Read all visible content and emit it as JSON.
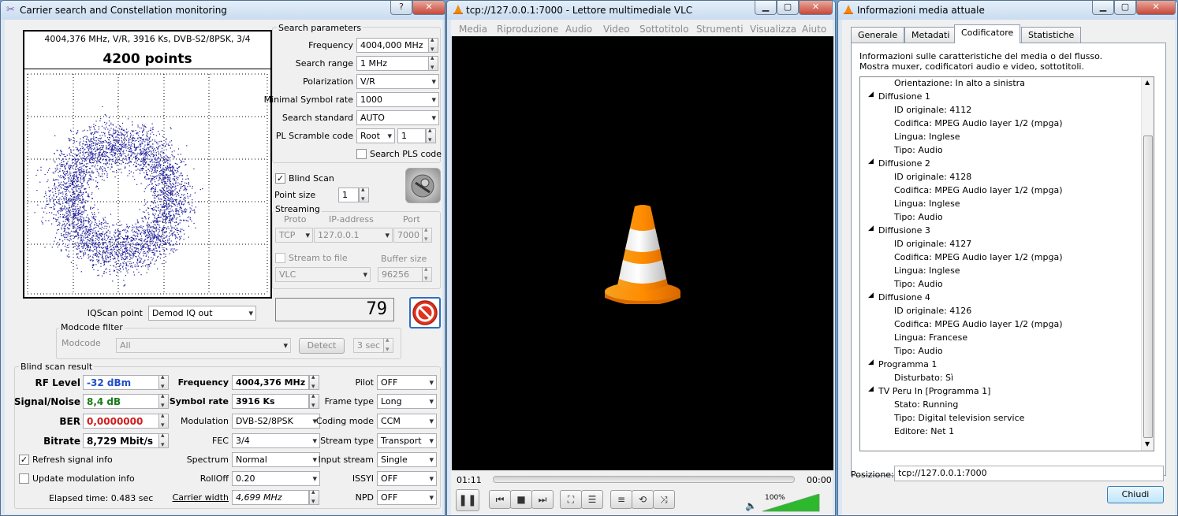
{
  "carrier": {
    "title": "Carrier search and Constellation monitoring",
    "help_btn": "?",
    "close_btn": "✕",
    "plot_header": "4004,376 MHz, V/R, 3916 Ks, DVB-S2/8PSK, 3/4",
    "plot_points": "4200 points",
    "search_params_title": "Search parameters",
    "frequency_label": "Frequency",
    "frequency_value": "4004,000 MHz",
    "range_label": "Search range",
    "range_value": "1 MHz",
    "polarization_label": "Polarization",
    "polarization_value": "V/R",
    "min_sr_label": "Minimal Symbol rate",
    "min_sr_value": "1000",
    "standard_label": "Search standard",
    "standard_value": "AUTO",
    "pl_label": "PL Scramble code",
    "pl_mode": "Root",
    "pl_value": "1",
    "pls_label": "Search PLS code",
    "blind_scan_label": "Blind Scan",
    "point_size_label": "Point size",
    "point_size_value": "1",
    "streaming_title": "Streaming",
    "proto_label": "Proto",
    "ip_label": "IP-address",
    "port_label": "Port",
    "proto_value": "TCP",
    "ip_value": "127.0.0.1",
    "port_value": "7000",
    "stream_file_label": "Stream to file",
    "buffer_label": "Buffer size",
    "player_value": "VLC",
    "buffer_value": "96256",
    "counter_value": "79",
    "iqscan_label": "IQScan point",
    "iqscan_value": "Demod IQ out",
    "modcode_filter_title": "Modcode filter",
    "modcode_label": "Modcode",
    "modcode_value": "All",
    "detect_btn": "Detect",
    "sec_value": "3 sec",
    "result_title": "Blind scan result",
    "rf_label": "RF Level",
    "rf_value": "-32 dBm",
    "sn_label": "Signal/Noise",
    "sn_value": "8,4 dB",
    "ber_label": "BER",
    "ber_value": "0,0000000",
    "bitrate_label": "Bitrate",
    "bitrate_value": "8,729 Mbit/s",
    "res_freq_label": "Frequency",
    "res_freq_value": "4004,376 MHz",
    "res_sr_label": "Symbol rate",
    "res_sr_value": "3916 Ks",
    "modulation_label": "Modulation",
    "modulation_value": "DVB-S2/8PSK",
    "fec_label": "FEC",
    "fec_value": "3/4",
    "spectrum_label": "Spectrum",
    "spectrum_value": "Normal",
    "rolloff_label": "RollOff",
    "rolloff_value": "0.20",
    "cw_label": "Carrier width",
    "cw_value": "4,699 MHz",
    "pilot_label": "Pilot",
    "pilot_value": "OFF",
    "frame_label": "Frame type",
    "frame_value": "Long",
    "coding_label": "Coding mode",
    "coding_value": "CCM",
    "stype_label": "Stream type",
    "stype_value": "Transport",
    "istream_label": "Input stream",
    "istream_value": "Single",
    "issyi_label": "ISSYI",
    "issyi_value": "OFF",
    "npd_label": "NPD",
    "npd_value": "OFF",
    "refresh_label": "Refresh signal info",
    "update_label": "Update modulation info",
    "elapsed": "Elapsed time: 0.483 sec"
  },
  "vlc": {
    "title": "tcp://127.0.0.1:7000 - Lettore multimediale VLC",
    "menu": [
      "Media",
      "Riproduzione",
      "Audio",
      "Video",
      "Sottotitolo",
      "Strumenti",
      "Visualizza",
      "Aiuto"
    ],
    "elapsed": "01:11",
    "total": "00:00",
    "volume": "100%",
    "volume_level": 1.0
  },
  "info": {
    "title": "Informazioni media attuale",
    "tabs": [
      "Generale",
      "Metadati",
      "Codificatore",
      "Statistiche"
    ],
    "desc1": "Informazioni sulle caratteristiche del media o del flusso.",
    "desc2": "Mostra muxer, codificatori audio e video, sottotitoli.",
    "tree": [
      "Orientazione: In alto a sinistra",
      "Diffusione 1",
      "ID originale: 4112",
      "Codifica: MPEG Audio layer 1/2 (mpga)",
      "Lingua: Inglese",
      "Tipo: Audio",
      "Diffusione 2",
      "ID originale: 4128",
      "Codifica: MPEG Audio layer 1/2 (mpga)",
      "Lingua: Inglese",
      "Tipo: Audio",
      "Diffusione 3",
      "ID originale: 4127",
      "Codifica: MPEG Audio layer 1/2 (mpga)",
      "Lingua: Inglese",
      "Tipo: Audio",
      "Diffusione 4",
      "ID originale: 4126",
      "Codifica: MPEG Audio layer 1/2 (mpga)",
      "Lingua: Francese",
      "Tipo: Audio",
      "Programma 1",
      "Disturbato: Sì",
      "TV Peru In [Programma 1]",
      "Stato: Running",
      "Tipo: Digital television service",
      "Editore: Net 1"
    ],
    "position_label": "Posizione:",
    "position_value": "tcp://127.0.0.1:7000",
    "close_btn": "Chiudi"
  }
}
